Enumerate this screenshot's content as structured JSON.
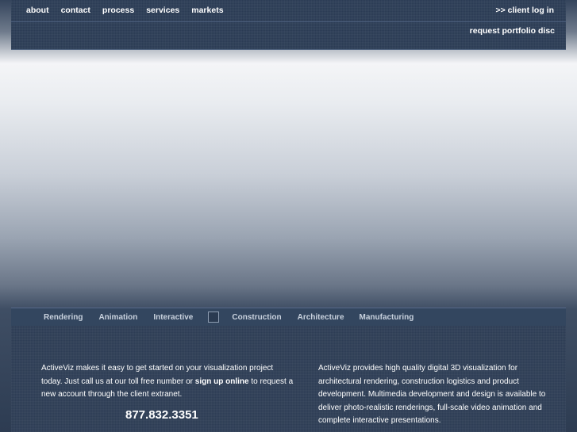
{
  "nav": {
    "items": [
      "about",
      "contact",
      "process",
      "services",
      "markets"
    ],
    "client_login": ">> client log in",
    "portfolio_request": "request portfolio disc"
  },
  "categories": {
    "left": [
      "Rendering",
      "Animation",
      "Interactive"
    ],
    "right": [
      "Construction",
      "Architecture",
      "Manufacturing"
    ]
  },
  "intro": {
    "text_before": "ActiveViz makes it easy to get started on your visualization project today. Just call us at our toll free number or ",
    "signup_link": "sign up online",
    "text_after": " to request a new account through the client extranet.",
    "phone": "877.832.3351"
  },
  "about": {
    "text": "ActiveViz provides high quality digital 3D visualization for architectural rendering, construction logistics and product development. Multimedia development and design is available to deliver photo-realistic renderings, full-scale video animation and complete interactive presentations."
  },
  "colors": {
    "nav_bg": "#2a3b54",
    "content_bg": "#2d3d55",
    "category_text": "#c9d2de"
  }
}
